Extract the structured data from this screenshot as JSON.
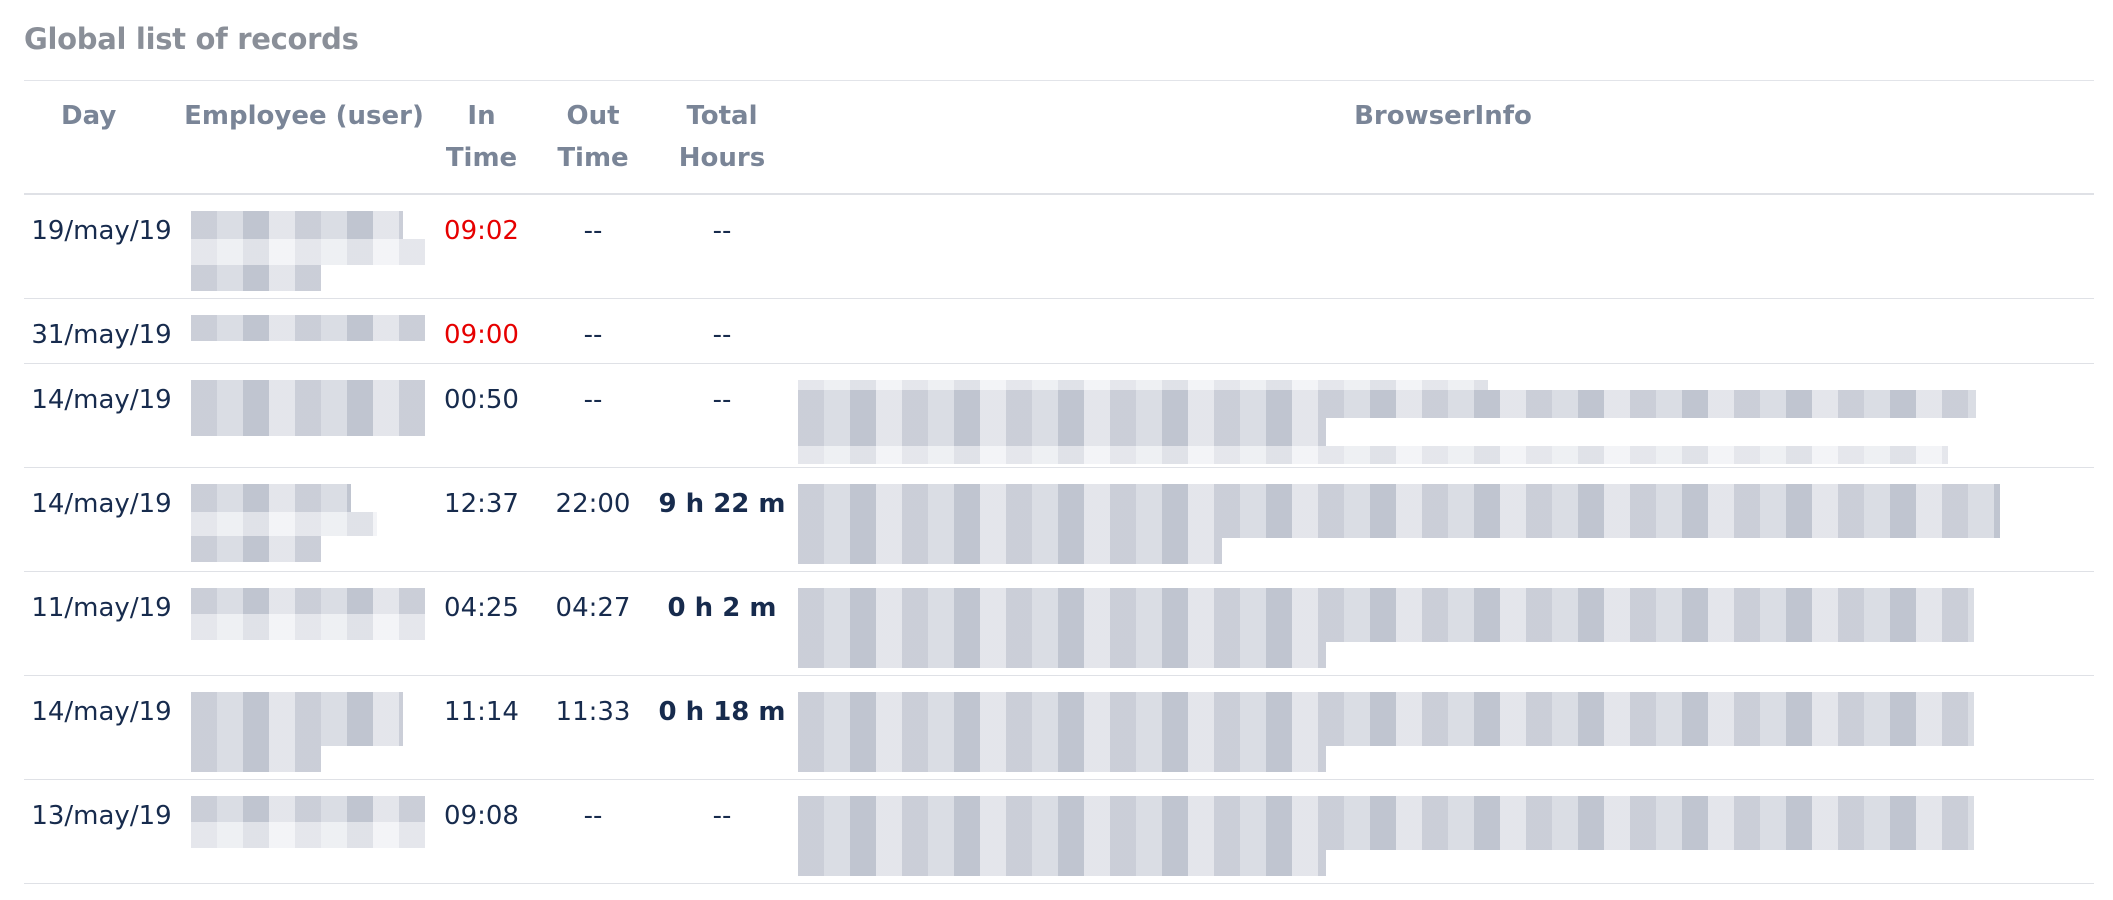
{
  "page": {
    "title": "Global list of records"
  },
  "table": {
    "headers": {
      "day": "Day",
      "employee": "Employee (user)",
      "in_time_1": "In",
      "in_time_2": "Time",
      "out_time_1": "Out",
      "out_time_2": "Time",
      "total_hours_1": "Total",
      "total_hours_2": "Hours",
      "browser_info": "BrowserInfo"
    },
    "rows": [
      {
        "day": "19/may/19",
        "employee": "",
        "in_time": "09:02",
        "out_time": "--",
        "total_hours": "--",
        "browser_info": "",
        "in_late": true
      },
      {
        "day": "31/may/19",
        "employee": "",
        "in_time": "09:00",
        "out_time": "--",
        "total_hours": "--",
        "browser_info": "",
        "in_late": true
      },
      {
        "day": "14/may/19",
        "employee": "",
        "in_time": "00:50",
        "out_time": "--",
        "total_hours": "--",
        "browser_info": "",
        "in_late": false
      },
      {
        "day": "14/may/19",
        "employee": "",
        "in_time": "12:37",
        "out_time": "22:00",
        "total_hours": "9 h 22 m",
        "browser_info": "",
        "in_late": false
      },
      {
        "day": "11/may/19",
        "employee": "",
        "in_time": "04:25",
        "out_time": "04:27",
        "total_hours": "0 h 2 m",
        "browser_info": "",
        "in_late": false
      },
      {
        "day": "14/may/19",
        "employee": "",
        "in_time": "11:14",
        "out_time": "11:33",
        "total_hours": "0 h 18 m",
        "browser_info": "",
        "in_late": false
      },
      {
        "day": "13/may/19",
        "employee": "",
        "in_time": "09:08",
        "out_time": "--",
        "total_hours": "--",
        "browser_info": "",
        "in_late": false
      }
    ]
  },
  "colors": {
    "late_in_time": "#e60000",
    "text": "#172b4d",
    "header_text": "#7a8597",
    "title_text": "#8a8f98",
    "border": "#dfe1e6"
  }
}
